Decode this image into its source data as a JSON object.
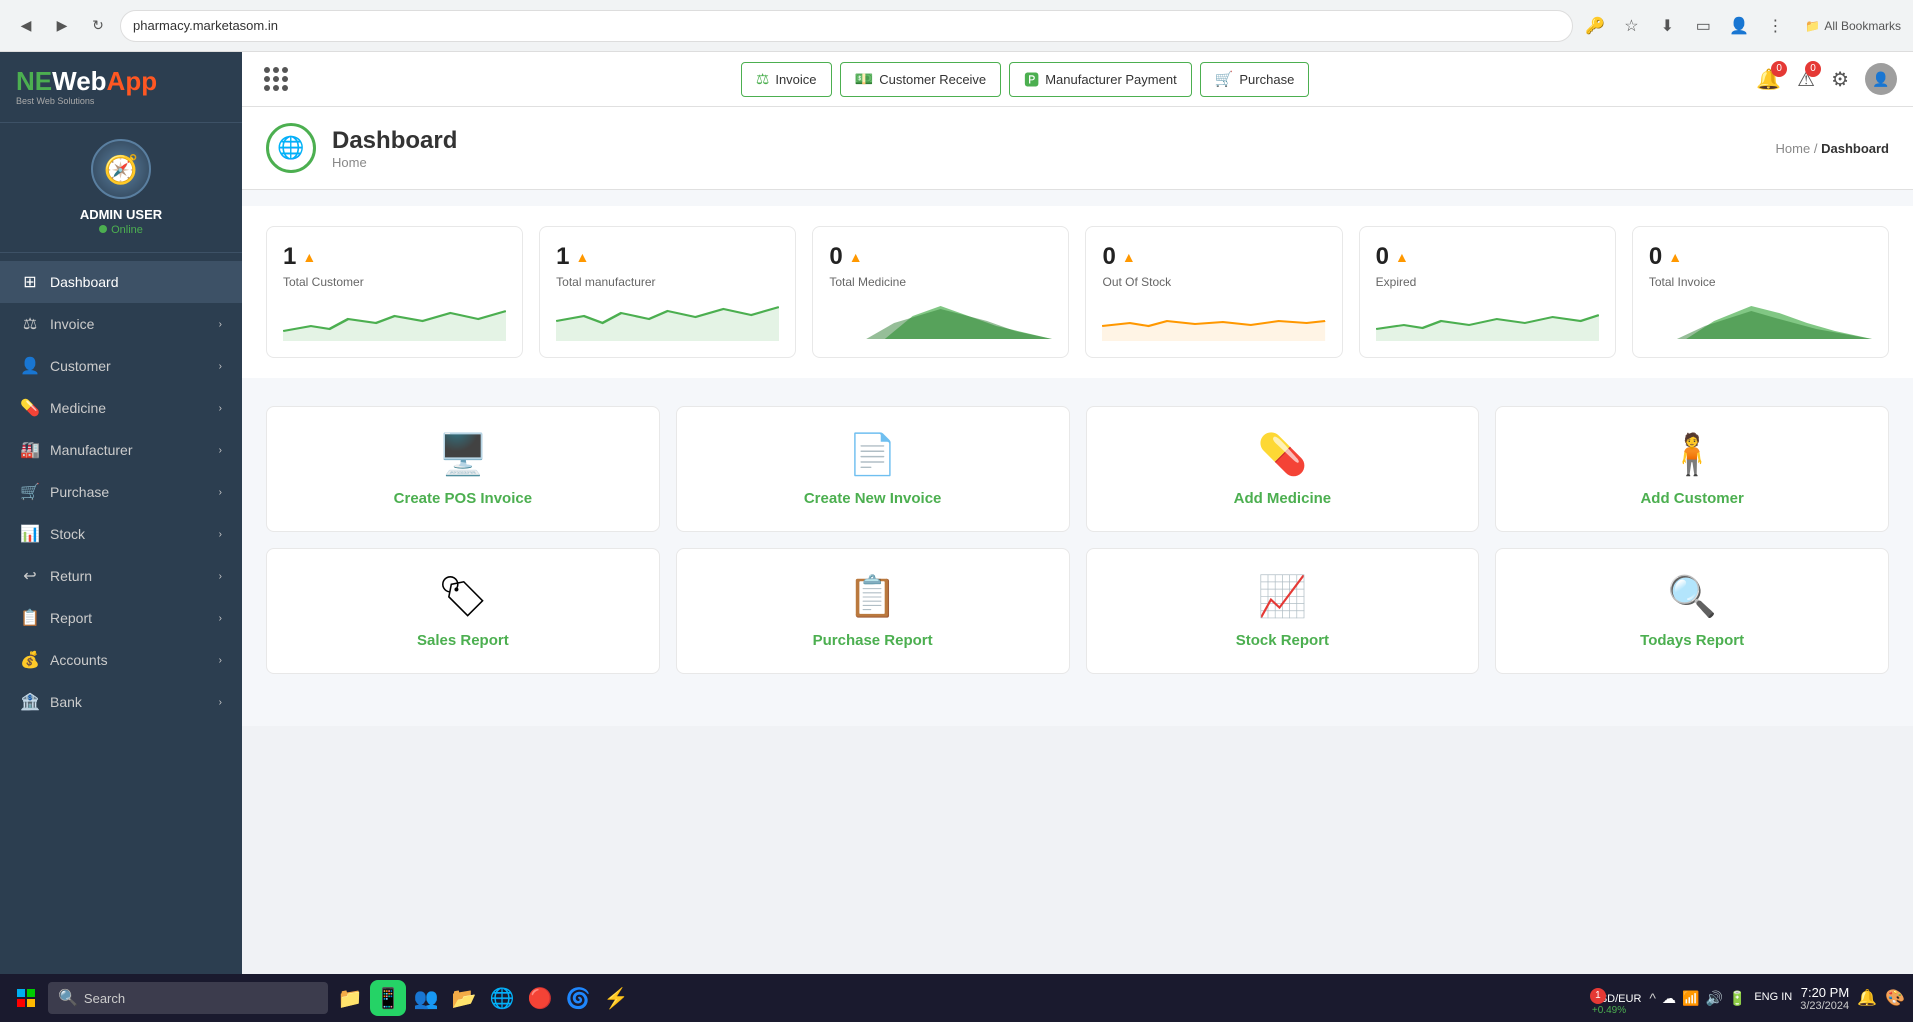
{
  "browser": {
    "url": "pharmacy.marketasom.in",
    "back_icon": "◀",
    "forward_icon": "▶",
    "reload_icon": "↻",
    "bookmarks_label": "All Bookmarks"
  },
  "sidebar": {
    "logo": {
      "ne": "NE",
      "web": "Web",
      "app": "App",
      "tagline": "Best Web Solutions"
    },
    "user": {
      "name": "ADMIN USER",
      "status": "Online"
    },
    "nav_items": [
      {
        "label": "Dashboard",
        "icon": "⊞",
        "has_arrow": false
      },
      {
        "label": "Invoice",
        "icon": "⚖",
        "has_arrow": true
      },
      {
        "label": "Customer",
        "icon": "👤",
        "has_arrow": true
      },
      {
        "label": "Medicine",
        "icon": "💊",
        "has_arrow": true
      },
      {
        "label": "Manufacturer",
        "icon": "🏭",
        "has_arrow": true
      },
      {
        "label": "Purchase",
        "icon": "🛒",
        "has_arrow": true
      },
      {
        "label": "Stock",
        "icon": "📊",
        "has_arrow": true
      },
      {
        "label": "Return",
        "icon": "↩",
        "has_arrow": true
      },
      {
        "label": "Report",
        "icon": "📋",
        "has_arrow": true
      },
      {
        "label": "Accounts",
        "icon": "💰",
        "has_arrow": true
      },
      {
        "label": "Bank",
        "icon": "🏦",
        "has_arrow": true
      }
    ]
  },
  "topbar": {
    "grid_label": "Grid Menu",
    "nav_buttons": [
      {
        "label": "Invoice",
        "icon": "⚖"
      },
      {
        "label": "Customer Receive",
        "icon": "💵"
      },
      {
        "label": "Manufacturer Payment",
        "icon": "🅿"
      },
      {
        "label": "Purchase",
        "icon": "🛒"
      }
    ],
    "notification_count": "0",
    "alert_count": "0"
  },
  "page": {
    "title": "Dashboard",
    "subtitle": "Home",
    "breadcrumb_home": "Home",
    "breadcrumb_current": "Dashboard"
  },
  "stats": [
    {
      "value": "1",
      "label": "Total Customer",
      "warning": true,
      "chart_type": "line_green"
    },
    {
      "value": "1",
      "label": "Total manufacturer",
      "warning": true,
      "chart_type": "line_green"
    },
    {
      "value": "0",
      "label": "Total Medicine",
      "warning": true,
      "chart_type": "mountain_green"
    },
    {
      "value": "0",
      "label": "Out Of Stock",
      "warning": true,
      "chart_type": "line_flat"
    },
    {
      "value": "0",
      "label": "Expired",
      "warning": true,
      "chart_type": "line_green2"
    },
    {
      "value": "0",
      "label": "Total Invoice",
      "warning": true,
      "chart_type": "mountain_green2"
    }
  ],
  "quick_actions": [
    {
      "label": "Create POS Invoice",
      "icon": "🖥"
    },
    {
      "label": "Create New Invoice",
      "icon": "📄"
    },
    {
      "label": "Add Medicine",
      "icon": "💊"
    },
    {
      "label": "Add Customer",
      "icon": "🧑‍🦯"
    }
  ],
  "quick_actions2": [
    {
      "label": "Sales Report",
      "icon": "🏷"
    },
    {
      "label": "Purchase Report",
      "icon": "📋"
    },
    {
      "label": "Stock Report",
      "icon": "📈"
    },
    {
      "label": "Todays Report",
      "icon": "🔍"
    }
  ],
  "taskbar": {
    "search_placeholder": "Search",
    "time": "7:20 PM",
    "date": "3/23/2024",
    "currency": "USD/EUR",
    "currency_change": "+0.49%",
    "currency_badge": "1",
    "lang": "ENG\nIN"
  }
}
